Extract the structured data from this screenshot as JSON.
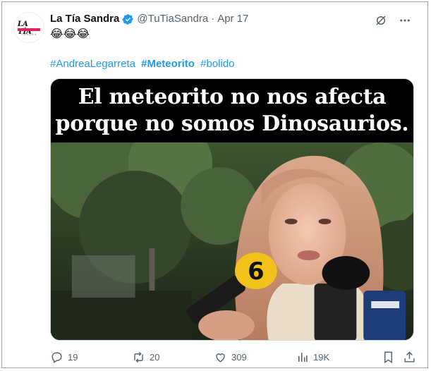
{
  "author": {
    "avatar_text": "LA TÍA",
    "avatar_sub": "SANDRA",
    "name": "La Tía Sandra",
    "handle": "@TuTiaSandra",
    "separator": "·",
    "date": "Apr 17"
  },
  "tweet": {
    "emojis": "😂😂😂",
    "hashtags": [
      {
        "text": "#AndreaLegarreta",
        "bold": false
      },
      {
        "text": "#Meteorito",
        "bold": true
      },
      {
        "text": "#bolido",
        "bold": false
      }
    ],
    "image_caption_line1": "El meteorito no nos afecta",
    "image_caption_line2": "porque no somos Dinosaurios.",
    "mic_channel": "6"
  },
  "stats": {
    "replies": "19",
    "retweets": "20",
    "likes": "309",
    "views": "19K"
  },
  "colors": {
    "link": "#1d9bf0",
    "muted": "#536471",
    "verified": "#1d9bf0"
  }
}
